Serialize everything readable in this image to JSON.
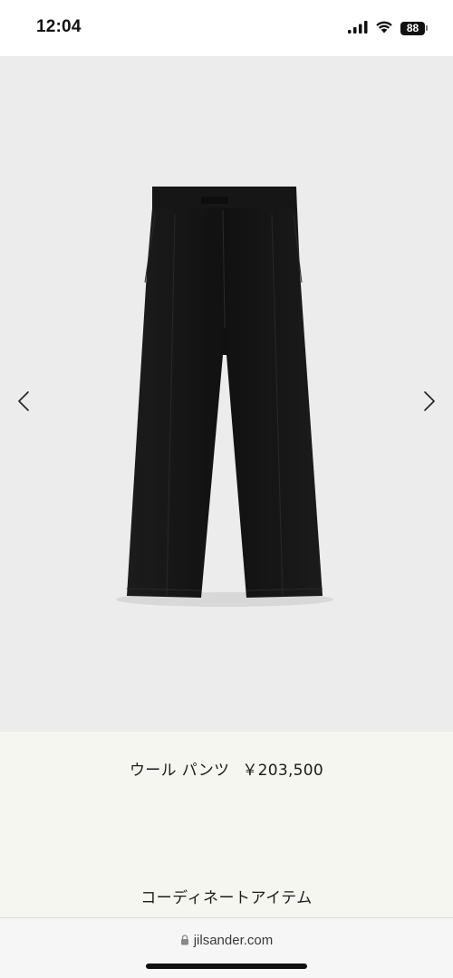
{
  "status_bar": {
    "time": "12:04",
    "battery_level": "88",
    "icons": [
      "cellular-signal-icon",
      "wifi-icon",
      "battery-icon"
    ]
  },
  "product_image": {
    "icons": [
      "chevron-left-icon",
      "chevron-right-icon"
    ]
  },
  "product": {
    "name": "ウール パンツ",
    "price": "￥203,500"
  },
  "section": {
    "coordinate_title": "コーディネートアイテム"
  },
  "browser": {
    "url": "jilsander.com",
    "icons": [
      "lock-icon"
    ]
  },
  "colors": {
    "image_background": "#ececec",
    "panel_background": "#f6f6f1",
    "pants": "#151515"
  }
}
